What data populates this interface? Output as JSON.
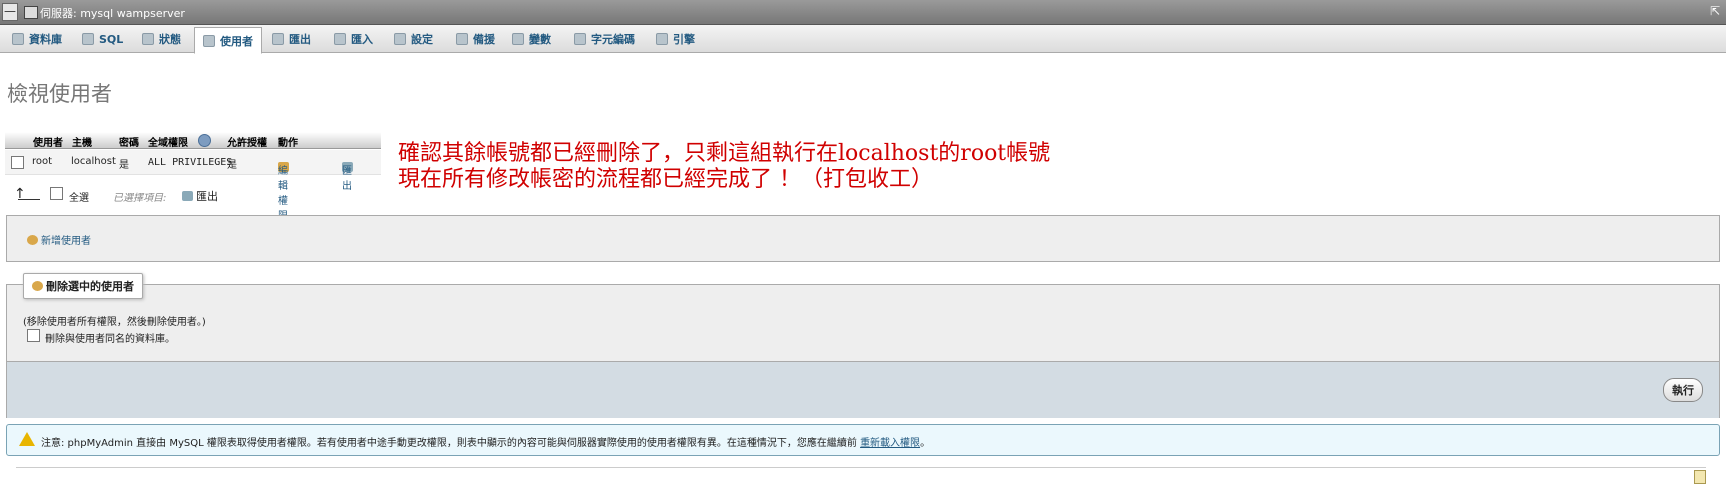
{
  "topbar": {
    "breadcrumb": "伺服器: mysql wampserver",
    "collapse_label": "—",
    "expand_label": "⇱"
  },
  "tabs": [
    {
      "label": "資料庫",
      "icon": "database-icon"
    },
    {
      "label": "SQL",
      "icon": "sql-icon"
    },
    {
      "label": "狀態",
      "icon": "status-icon"
    },
    {
      "label": "使用者",
      "icon": "users-icon",
      "active": true
    },
    {
      "label": "匯出",
      "icon": "export-icon"
    },
    {
      "label": "匯入",
      "icon": "import-icon"
    },
    {
      "label": "設定",
      "icon": "settings-icon"
    },
    {
      "label": "備援",
      "icon": "replication-icon"
    },
    {
      "label": "變數",
      "icon": "variables-icon"
    },
    {
      "label": "字元編碼",
      "icon": "charset-icon"
    },
    {
      "label": "引擎",
      "icon": "engine-icon"
    }
  ],
  "page_title": "檢視使用者",
  "users_table": {
    "headers": [
      "使用者",
      "主機",
      "密碼",
      "全域權限",
      "允許授權",
      "動作"
    ],
    "rows": [
      {
        "user": "root",
        "host": "localhost",
        "password": "是",
        "privileges": "ALL PRIVILEGES",
        "grant": "是",
        "edit": "編輯權限",
        "export": "匯出"
      }
    ]
  },
  "annotation": {
    "line1": "確認其餘帳號都已經刪除了，只剩這組執行在localhost的root帳號",
    "line2": "現在所有修改帳密的流程都已經完成了 ！（打包收工）"
  },
  "selection": {
    "check_all": "全選",
    "with_selected": "已選擇項目:",
    "export": "匯出"
  },
  "add_user": {
    "label": "新增使用者"
  },
  "remove_users": {
    "legend": "刪除選中的使用者",
    "hint": "(移除使用者所有權限，然後刪除使用者。)",
    "drop_db_label": "刪除與使用者同名的資料庫。",
    "go_button": "執行"
  },
  "notice": {
    "text": "注意: phpMyAdmin 直接由 MySQL 權限表取得使用者權限。若有使用者中途手動更改權限，則表中顯示的內容可能與伺服器實際使用的使用者權限有異。在這種情況下，您應在繼續前",
    "link": "重新載入權限",
    "suffix": "。"
  },
  "colors": {
    "link": "#235a81",
    "annotation": "#d00000",
    "panel": "#eeeeee",
    "footer_bar": "#d3dce3"
  }
}
